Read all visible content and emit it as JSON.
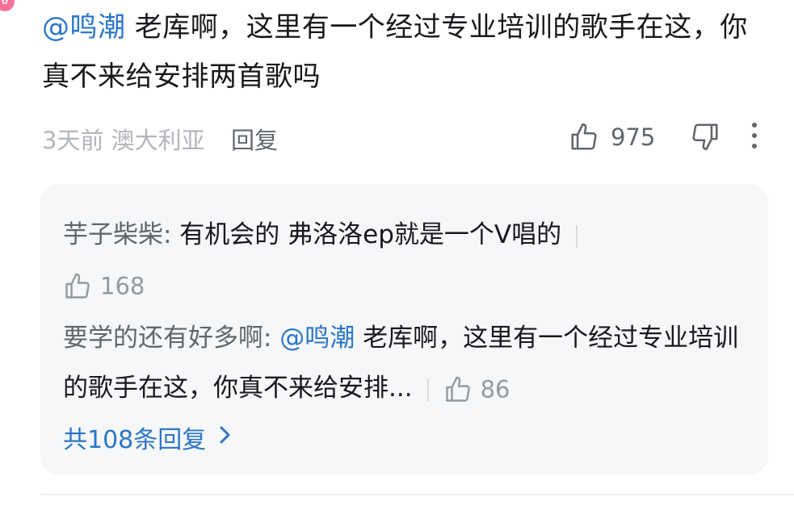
{
  "comment": {
    "mention": "@鸣潮",
    "text": " 老库啊，这里有一个经过专业培训的歌手在这，你真不来给安排两首歌吗",
    "meta_time_location": "3天前 澳大利亚",
    "reply_label": "回复",
    "like_count": "975"
  },
  "replies": [
    {
      "author": "芋子柴柴:",
      "text": " 有机会的 弗洛洛ep就是一个V唱的",
      "like_count": "168"
    },
    {
      "author": "要学的还有好多啊:",
      "mention": " @鸣潮",
      "text": " 老库啊，这里有一个经过专业培训的歌手在这，你真不来给安排...",
      "like_count": "86"
    }
  ],
  "more_replies_label": "共108条回复",
  "colors": {
    "link_blue": "#2b76c8",
    "text_dark": "#18191c",
    "text_grey": "#61666d",
    "reply_bg": "#f6f7f8"
  },
  "icons": [
    "thumb-up-icon",
    "thumb-down-icon",
    "more-vertical-icon",
    "chevron-right-icon"
  ]
}
